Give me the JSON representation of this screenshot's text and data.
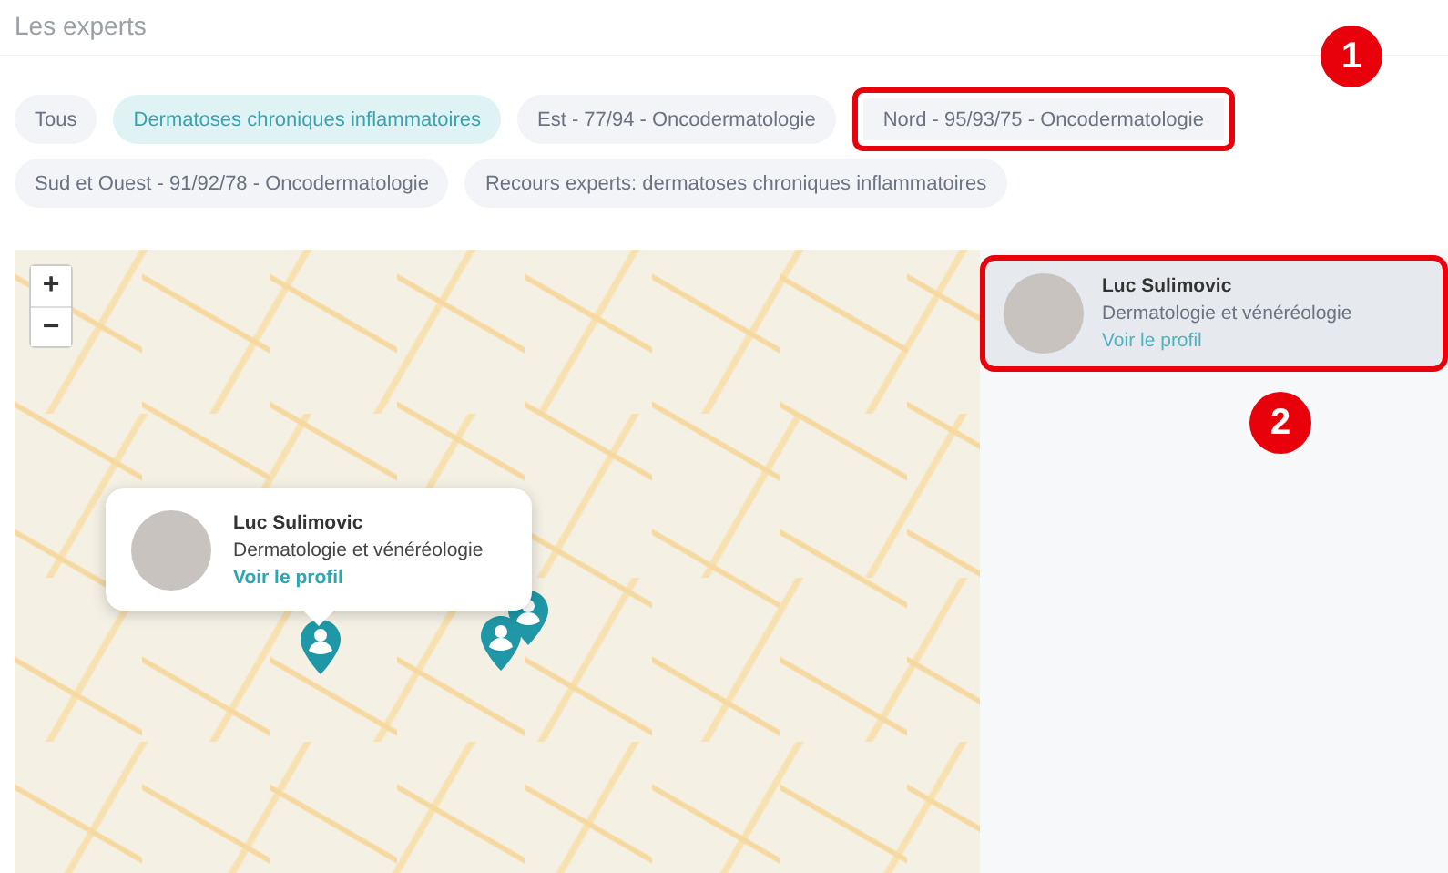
{
  "title": "Les experts",
  "filters": [
    {
      "label": "Tous",
      "selected": false,
      "highlighted": false
    },
    {
      "label": "Dermatoses chroniques inflammatoires",
      "selected": true,
      "highlighted": false
    },
    {
      "label": "Est - 77/94 - Oncodermatologie",
      "selected": false,
      "highlighted": false
    },
    {
      "label": "Nord - 95/93/75 - Oncodermatologie",
      "selected": false,
      "highlighted": true
    },
    {
      "label": "Sud et Ouest - 91/92/78 - Oncodermatologie",
      "selected": false,
      "highlighted": false
    },
    {
      "label": "Recours experts: dermatoses chroniques inflammatoires",
      "selected": false,
      "highlighted": false
    }
  ],
  "map": {
    "zoom_in": "+",
    "zoom_out": "−",
    "popup": {
      "name": "Luc Sulimovic",
      "specialty": "Dermatologie et vénéréologie",
      "link": "Voir le profil"
    }
  },
  "experts": [
    {
      "name": "Luc Sulimovic",
      "specialty": "Dermatologie et vénéréologie",
      "link": "Voir le profil",
      "selected": true,
      "highlighted": true
    }
  ],
  "annotations": [
    {
      "number": "1"
    },
    {
      "number": "2"
    }
  ]
}
